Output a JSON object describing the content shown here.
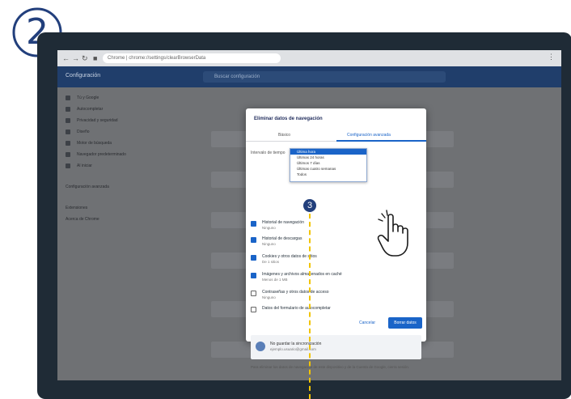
{
  "step": {
    "number": "2"
  },
  "callout": {
    "number": "3"
  },
  "browser": {
    "url": "Chrome | chrome://settings/clearBrowserData"
  },
  "settings": {
    "title": "Configuración",
    "search_placeholder": "Buscar configuración",
    "sidebar": [
      {
        "label": "Tú y Google",
        "icon": "person-icon"
      },
      {
        "label": "Autocompletar",
        "icon": "key-icon"
      },
      {
        "label": "Privacidad y seguridad",
        "icon": "shield-icon"
      },
      {
        "label": "Diseño",
        "icon": "palette-icon"
      },
      {
        "label": "Motor de búsqueda",
        "icon": "search-icon"
      },
      {
        "label": "Navegador predeterminado",
        "icon": "browser-icon"
      },
      {
        "label": "Al iniciar",
        "icon": "power-icon"
      }
    ],
    "sidebar_extra": [
      {
        "label": "Configuración avanzada"
      },
      {
        "label": "Extensiones"
      },
      {
        "label": "Acerca de Chrome"
      }
    ]
  },
  "dialog": {
    "title": "Eliminar datos de navegación",
    "tabs": [
      "Básico",
      "Configuración avanzada"
    ],
    "time_range_label": "Intervalo de tiempo",
    "time_options": [
      "Última hora",
      "Últimas 24 horas",
      "Últimos 7 días",
      "Últimas cuatro semanas",
      "Todos"
    ],
    "options": [
      {
        "title": "Historial de navegación",
        "subtitle": "Ninguno",
        "checked": true
      },
      {
        "title": "Historial de descargas",
        "subtitle": "Ninguno",
        "checked": true
      },
      {
        "title": "Cookies y otros datos de sitios",
        "subtitle": "De 1 sitios",
        "checked": true
      },
      {
        "title": "Imágenes y archivos almacenados en caché",
        "subtitle": "Menos de 1 MB",
        "checked": true
      },
      {
        "title": "Contraseñas y otros datos de acceso",
        "subtitle": "Ninguno",
        "checked": false
      },
      {
        "title": "Datos del formulario de autocompletar",
        "subtitle": "",
        "checked": false
      }
    ],
    "cancel_label": "Cancelar",
    "clear_label": "Borrar datos",
    "account": {
      "name": "No guardar la sincronización",
      "email": "ejemplo.usuario@gmail.com"
    },
    "footer": "Para eliminar los datos de navegación de este dispositivo y de la Cuenta de Google, cierra sesión."
  },
  "colors": {
    "accent": "#1a64c8",
    "monitor_frame": "#1f2b36",
    "step_badge": "#223f7c",
    "guide_line": "#f2c400"
  }
}
